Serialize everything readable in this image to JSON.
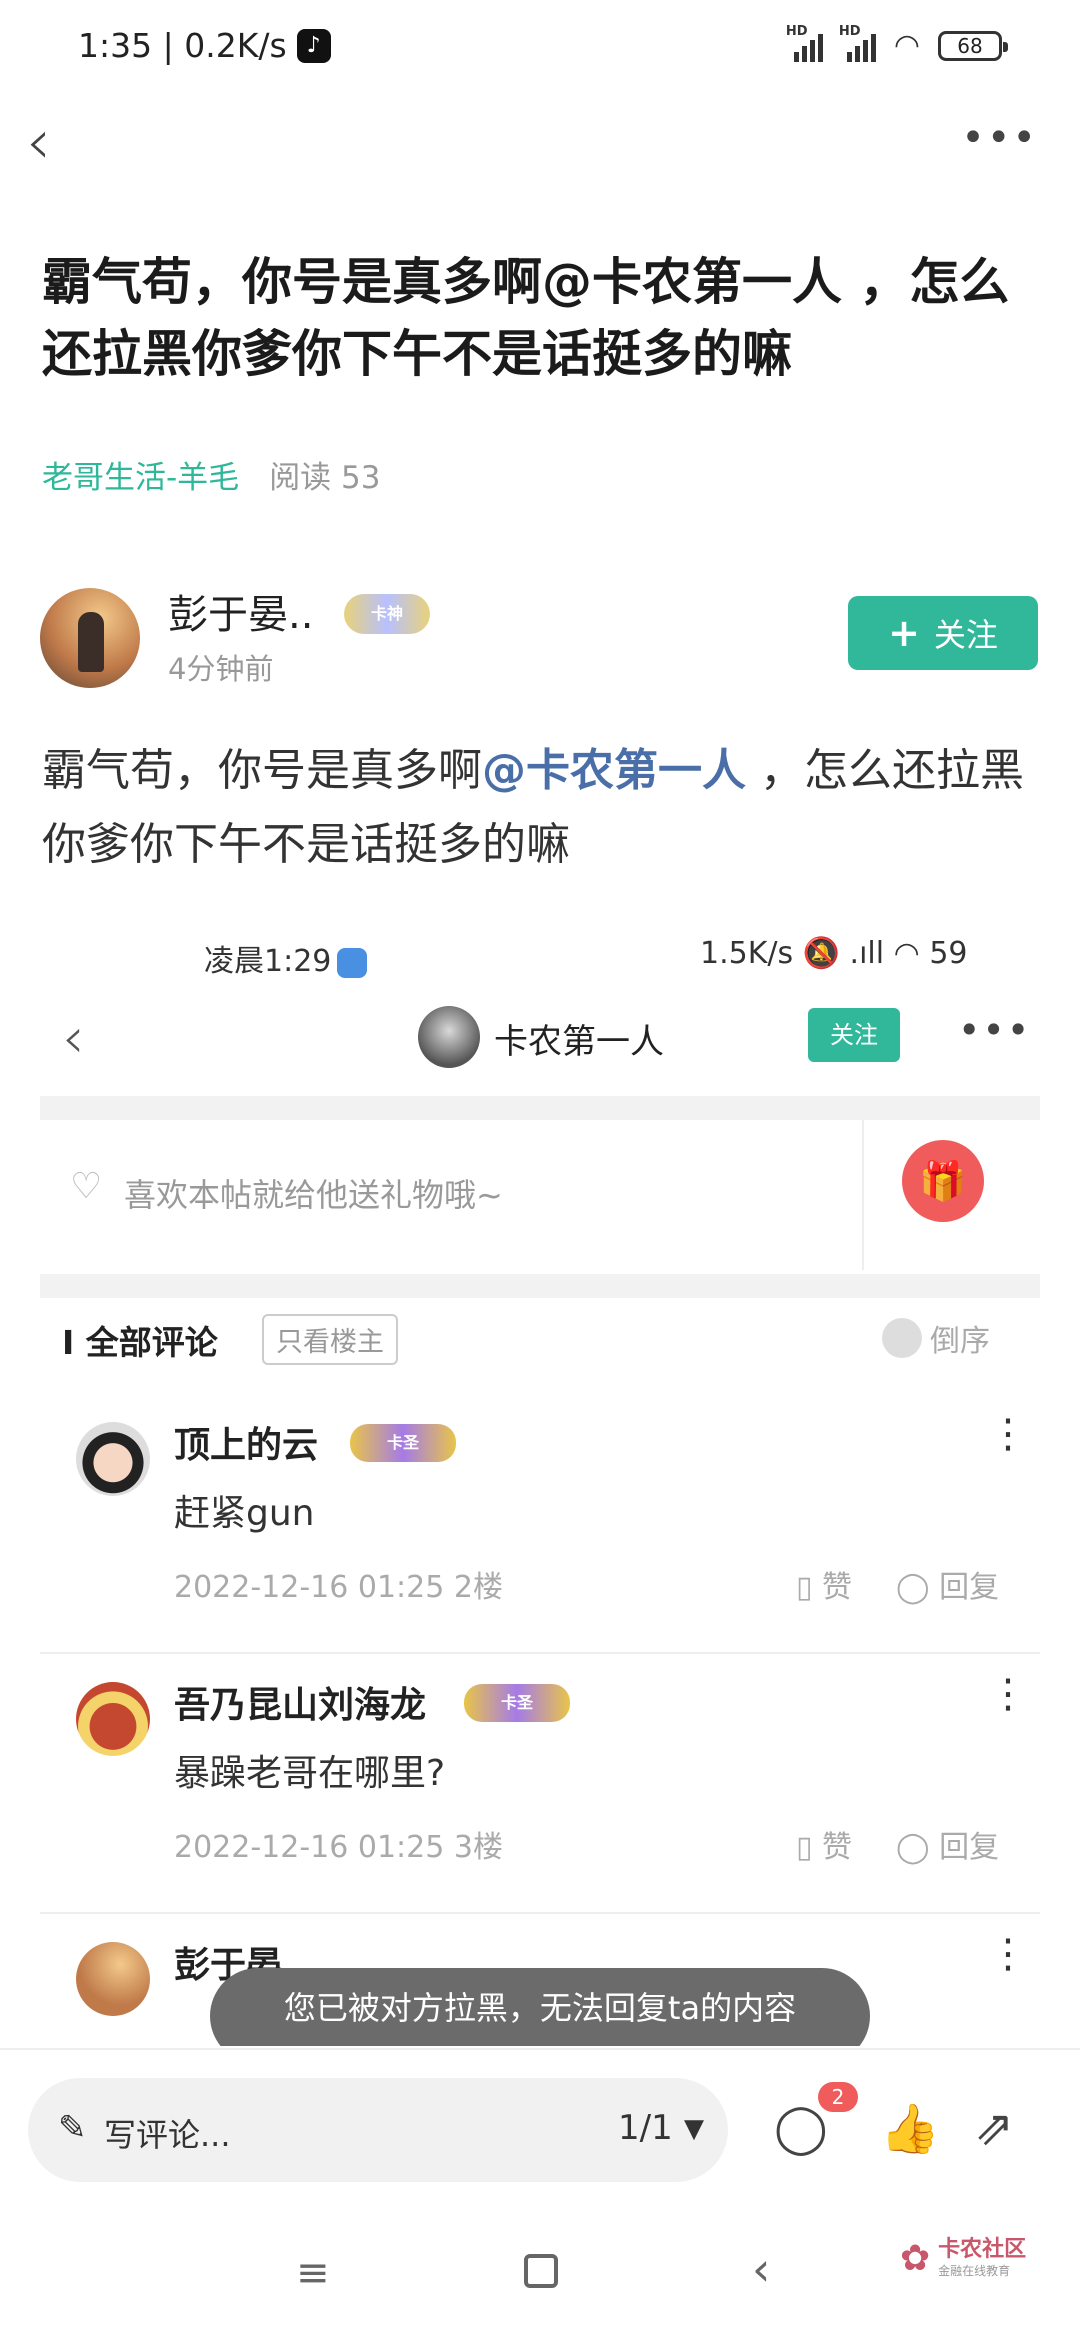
{
  "status_bar": {
    "time": "1:35",
    "net_speed": "0.2K/s",
    "battery": "68"
  },
  "post": {
    "title": "霸气苟，你号是真多啊@卡农第一人 ，怎么还拉黑你爹你下午不是话挺多的嘛",
    "category": "老哥生活-羊毛",
    "reads": "阅读 53",
    "author_name": "彭于晏..",
    "author_badge": "卡神",
    "author_time": "4分钟前",
    "follow_label": "关注",
    "body_prefix": "霸气苟，你号是真多啊",
    "body_mention": "@卡农第一人",
    "body_suffix": " ，怎么还拉黑你爹你下午不是话挺多的嘛"
  },
  "embed": {
    "status_time": "凌晨1:29",
    "status_right": "1.5K/s",
    "battery": "59",
    "user_name": "卡农第一人",
    "follow_label": "关注",
    "gift_prompt": "喜欢本帖就给他送礼物哦~",
    "comments_header": "全部评论",
    "only_host": "只看楼主",
    "sort_label": "倒序",
    "comments": [
      {
        "name": "顶上的云",
        "badge": "卡圣",
        "text": "赶紧gun",
        "meta": "2022-12-16 01:25  2楼",
        "like": "赞",
        "reply": "回复"
      },
      {
        "name": "吾乃昆山刘海龙",
        "badge": "卡圣",
        "text": "暴躁老哥在哪里?",
        "meta": "2022-12-16 01:25  3楼",
        "like": "赞",
        "reply": "回复"
      },
      {
        "name": "彭于晏"
      }
    ],
    "toast": "您已被对方拉黑，无法回复ta的内容"
  },
  "bottom_bar": {
    "input_placeholder": "写评论...",
    "page_indicator": "1/1",
    "comment_count": "2"
  },
  "watermark": {
    "title": "卡农社区",
    "subtitle": "金融在线教育"
  }
}
